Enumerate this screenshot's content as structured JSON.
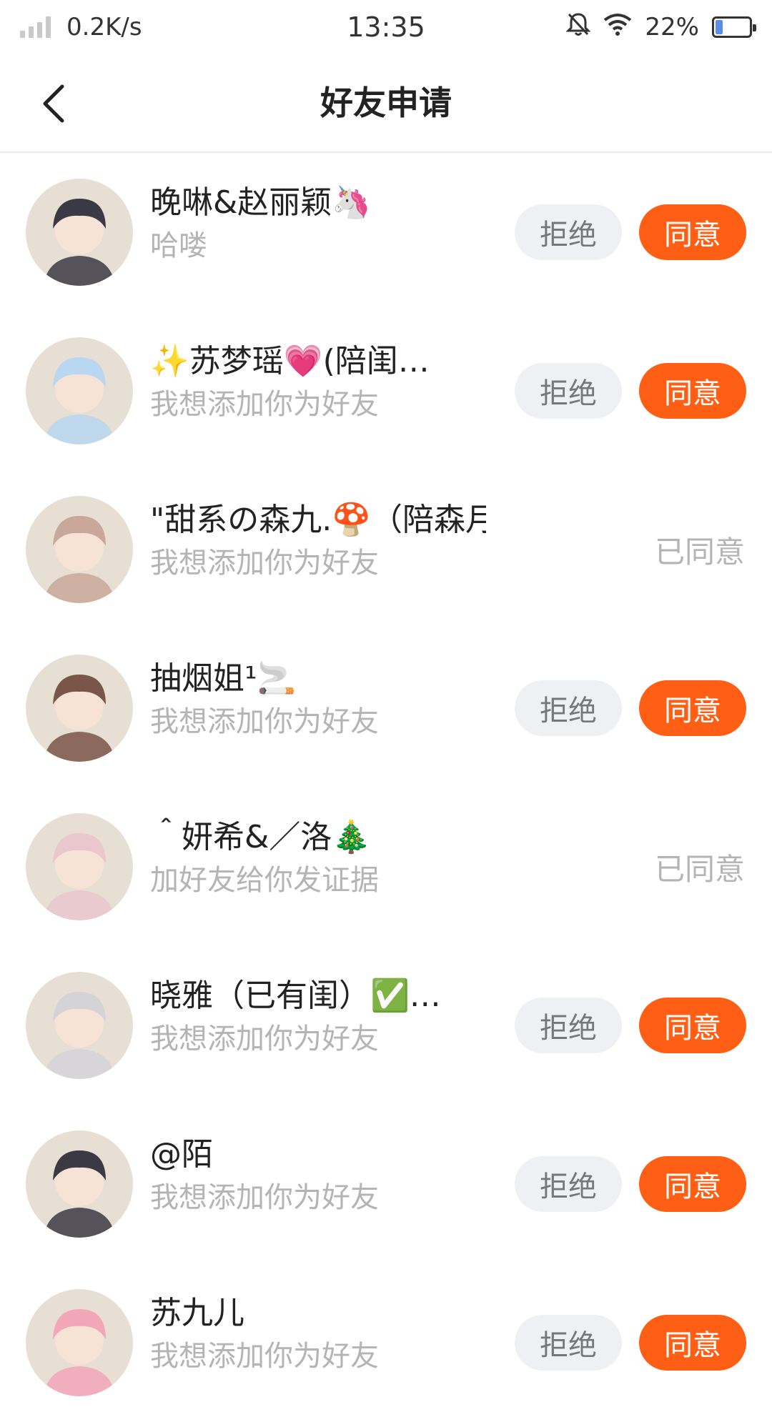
{
  "status_bar": {
    "net_speed": "0.2K/s",
    "time": "13:35",
    "battery": "22%",
    "battery_level": 0.22,
    "icons": [
      "signal-icon",
      "mute-bell-icon",
      "wifi-icon",
      "battery-icon"
    ]
  },
  "nav": {
    "title": "好友申请",
    "back_icon": "chevron-left-icon"
  },
  "requests": [
    {
      "name": "晚啉&赵丽颖🦄",
      "message": "哈喽",
      "status": "pending",
      "avatar_color": "#3b3a44"
    },
    {
      "name": "✨苏梦瑶💗(陪闺…",
      "message": "我想添加你为好友",
      "status": "pending",
      "avatar_color": "#b9d7f0"
    },
    {
      "name": "\"甜系の森九.🍄（陪森月…",
      "message": "我想添加你为好友",
      "status": "accepted",
      "avatar_color": "#c9a89a"
    },
    {
      "name": "抽烟姐¹🚬",
      "message": "我想添加你为好友",
      "status": "pending",
      "avatar_color": "#7a5648"
    },
    {
      "name": "＾妍希&／洛🎄",
      "message": "加好友给你发证据",
      "status": "accepted",
      "avatar_color": "#e9c7cc"
    },
    {
      "name": "晓雅（已有闺）✅…",
      "message": "我想添加你为好友",
      "status": "pending",
      "avatar_color": "#d4d4d8"
    },
    {
      "name": "@陌",
      "message": "我想添加你为好友",
      "status": "pending",
      "avatar_color": "#3b3a44"
    },
    {
      "name": "苏九儿",
      "message": "我想添加你为好友",
      "status": "pending",
      "avatar_color": "#f2a7b8"
    }
  ],
  "labels": {
    "reject": "拒绝",
    "accept": "同意",
    "accepted": "已同意"
  },
  "colors": {
    "accent": "#ff5f14",
    "reject_bg": "#eef0f4",
    "muted_text": "#b4b4b4"
  }
}
